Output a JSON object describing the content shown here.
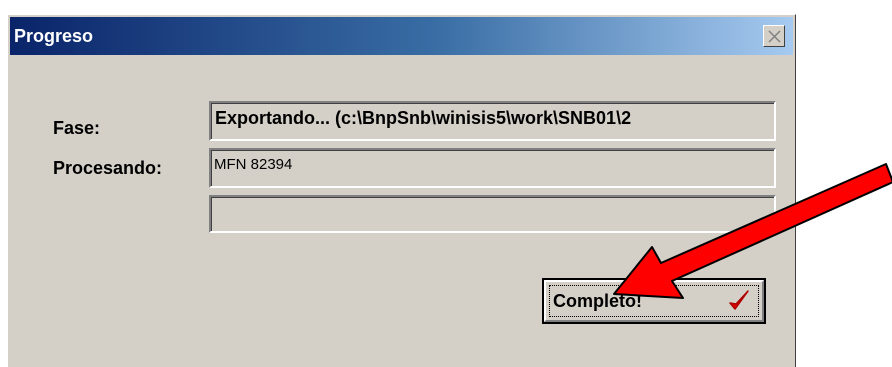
{
  "window": {
    "title": "Progreso"
  },
  "form": {
    "fase_label": "Fase:",
    "fase_value": "Exportando... (c:\\BnpSnb\\winisis5\\work\\SNB01\\2",
    "procesando_label": "Procesando:",
    "procesando_value": "MFN 82394",
    "progress_percent": 0
  },
  "buttons": {
    "complete_label": "Completo!"
  },
  "icons": {
    "close": "close-icon",
    "check": "checkmark-icon",
    "arrow": "red-arrow-annotation"
  },
  "colors": {
    "titlebar_start": "#0a246a",
    "titlebar_end": "#a6caf0",
    "face": "#d4d0c8",
    "check": "#e00000",
    "arrow": "#ff0000"
  }
}
